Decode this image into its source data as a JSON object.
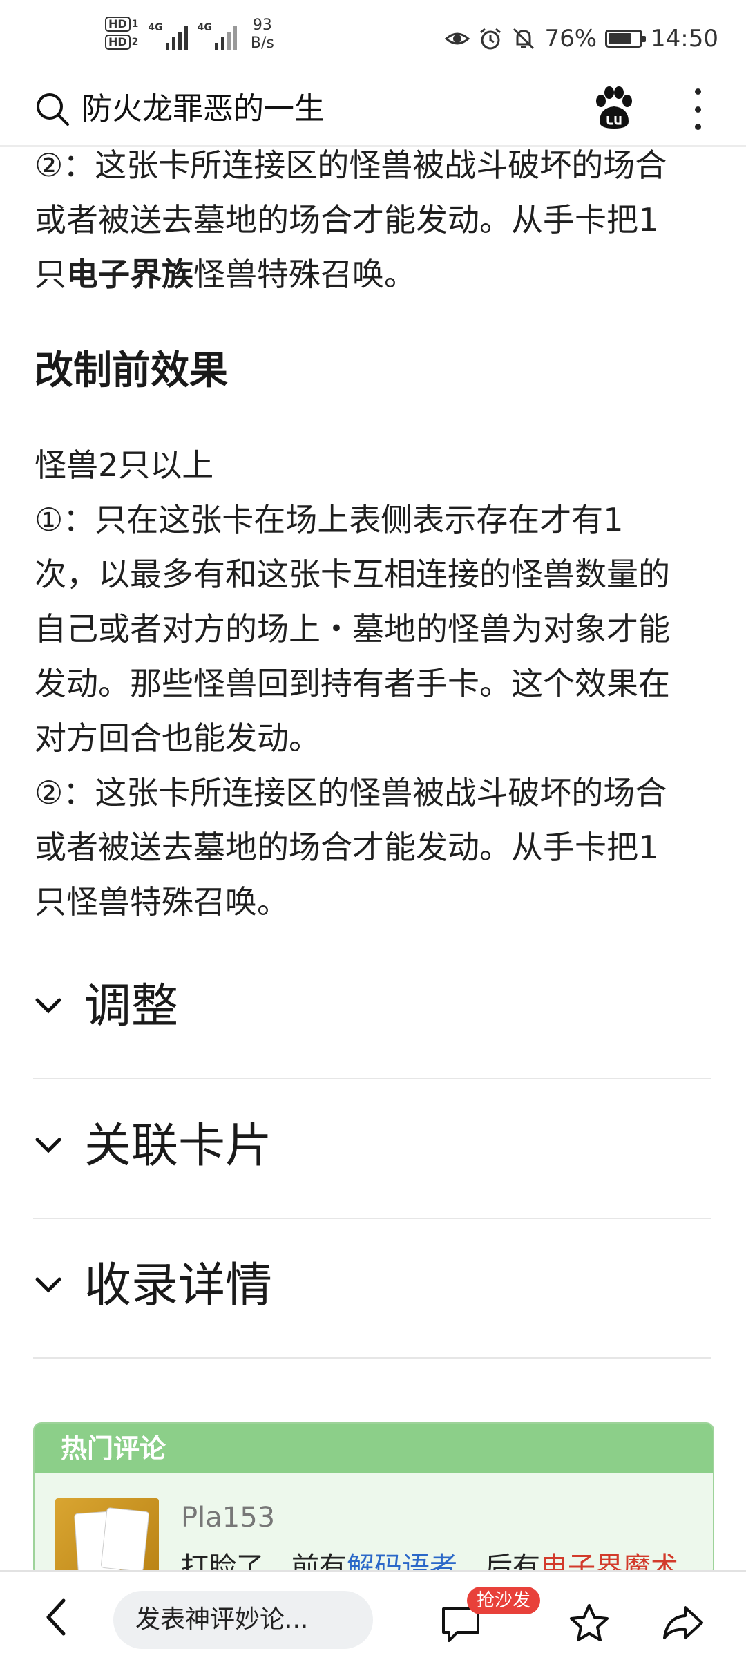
{
  "status_bar": {
    "sim1_label": "HD",
    "sim1_index": "1",
    "sim2_label": "HD",
    "sim2_index": "2",
    "network1": "4G",
    "network2": "4G",
    "speed_value": "93",
    "speed_unit": "B/s",
    "battery_percent": "76%",
    "battery_level": 0.76,
    "time": "14:50",
    "icons": [
      "eye-icon",
      "alarm-icon",
      "bell-off-icon",
      "battery-icon"
    ]
  },
  "search_header": {
    "query": "防火龙罪恶的一生",
    "icons": [
      "search-icon",
      "baidu-paw-icon",
      "more-vertical-icon"
    ]
  },
  "article": {
    "effect2_line1": "②：这张卡所连接区的怪兽被战斗破坏的场合",
    "effect2_line2": "或者被送去墓地的场合才能发动。从手卡把1",
    "effect2_line3_pre": "只",
    "effect2_line3_bold": "电子界族",
    "effect2_line3_post": "怪兽特殊召唤。",
    "section_title": "改制前效果",
    "old_lines": [
      "怪兽2只以上",
      "①：只在这张卡在场上表侧表示存在才有1",
      "次，以最多有和这张卡互相连接的怪兽数量的",
      "自己或者对方的场上・墓地的怪兽为对象才能",
      "发动。那些怪兽回到持有者手卡。这个效果在",
      "对方回合也能发动。",
      "②：这张卡所连接区的怪兽被战斗破坏的场合",
      "或者被送去墓地的场合才能发动。从手卡把1",
      "只怪兽特殊召唤。"
    ]
  },
  "sections": [
    {
      "label": "调整"
    },
    {
      "label": "关联卡片"
    },
    {
      "label": "收录详情"
    }
  ],
  "hot_comments": {
    "header": "热门评论",
    "user": "Pla153",
    "text_a": "打脸了，前有",
    "link1": "解码语者",
    "text_b": "，后有",
    "link2": "电子界魔术"
  },
  "bottom_bar": {
    "input_placeholder": "发表神评妙论...",
    "sofa_badge": "抢沙发",
    "icons": [
      "back-icon",
      "comment-icon",
      "star-icon",
      "share-icon"
    ]
  }
}
